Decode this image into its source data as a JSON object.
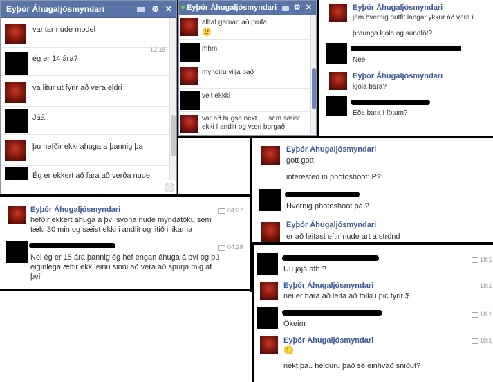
{
  "chat1": {
    "title": "Eyþór Áhugaljósmyndari",
    "close": "✕",
    "gear": "⚙",
    "time": "12:18",
    "messages": [
      "vantar nude model",
      "ég er 14 ára?",
      "va litur ut fyrir að vera eldri",
      "Jáá..",
      "þu hefðir ekki ahuga a þannig þa",
      "Ég er ekkert að fara að verða nude"
    ]
  },
  "chat2": {
    "title": "Eyþór Áhugaljósmyndari",
    "close": "✕",
    "gear": "⚙",
    "messages": [
      "alltaf gaman að prufa",
      "mhm",
      "myndiru vilja það",
      "veit ekkki",
      "var að hugsa nekt. . . sem sæist ekki í andlit og væri borgað"
    ],
    "emoticon": "🙂"
  },
  "chat3": {
    "name": "Eyþór Áhugaljósmyndari",
    "messages": [
      "jám hvernig outfit langar ykkur að vera í",
      "þraunga kjóla og sundföt?",
      "Nee",
      "kjola bara?",
      "Eða bara í fötum?"
    ]
  },
  "chat4": {
    "name": "Eyþór Áhugaljósmyndari",
    "messages": [
      "gott gott",
      "interested in photoshoot: P?",
      "Hvernig photoshoot þá ?",
      "er að leitast eftir nude art a strönd"
    ]
  },
  "chat5": {
    "name": "Eyþór Áhugaljósmyndari",
    "time1": "04:27",
    "time2": "04:28",
    "msg1": "hefðir ekkert ahuga a því svona nude myndatöku sem tæki 30 min og sæist ekki i andlit og litið i likama",
    "msg2": "Nei ég er 15 ára þannig ég hef engan áhuga á því og þú eiginlega ættir ekki einu sinni að vera að spurja mig af því"
  },
  "chat6": {
    "name": "Eyþór Áhugaljósmyndari",
    "time": "18:1",
    "messages": [
      "Uu jájá afh ?",
      "nei er bara að leita að folki i pic fyrir $",
      "Okeim",
      "nekt þa.. helduru það sé einhvað sniðut?"
    ],
    "emoticon": "🙂"
  }
}
